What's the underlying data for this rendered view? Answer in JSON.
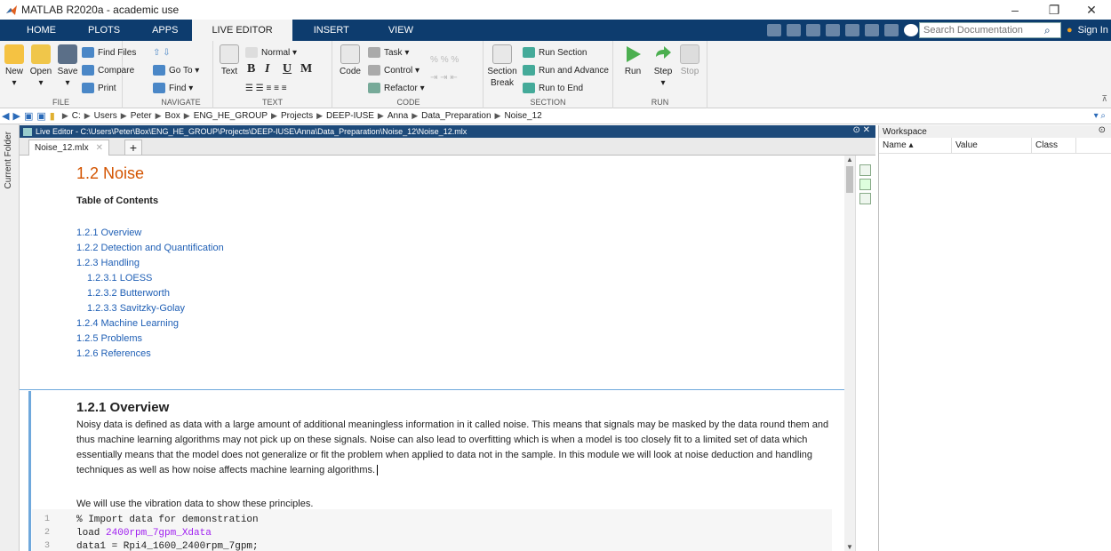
{
  "window": {
    "title": "MATLAB R2020a - academic use",
    "controls": {
      "minimize": "–",
      "restore": "❐",
      "close": "✕"
    }
  },
  "ribbon_tabs": [
    "HOME",
    "PLOTS",
    "APPS",
    "LIVE EDITOR",
    "INSERT",
    "VIEW"
  ],
  "search": {
    "placeholder": "Search Documentation"
  },
  "sign_in": "Sign In",
  "ribbon": {
    "file": {
      "label": "FILE",
      "new": "New",
      "open": "Open",
      "save": "Save",
      "find_files": "Find Files",
      "compare": "Compare",
      "print": "Print"
    },
    "navigate": {
      "label": "NAVIGATE",
      "go_to": "Go To ▾",
      "find": "Find ▾"
    },
    "text": {
      "label": "TEXT",
      "text": "Text",
      "style": "Normal ▾",
      "bold": "B",
      "italic": "I",
      "underline": "U",
      "mono": "M"
    },
    "code": {
      "label": "CODE",
      "code": "Code",
      "task": "Task ▾",
      "control": "Control ▾",
      "refactor": "Refactor ▾"
    },
    "section": {
      "label": "SECTION",
      "break_line1": "Section",
      "break_line2": "Break",
      "run_section": "Run Section",
      "run_and_advance": "Run and Advance",
      "run_to_end": "Run to End"
    },
    "run": {
      "label": "RUN",
      "run": "Run",
      "step": "Step",
      "stop": "Stop"
    }
  },
  "breadcrumbs": [
    "C:",
    "Users",
    "Peter",
    "Box",
    "ENG_HE_GROUP",
    "Projects",
    "DEEP-IUSE",
    "Anna",
    "Data_Preparation",
    "Noise_12"
  ],
  "side_panel": {
    "label": "Current Folder"
  },
  "editor": {
    "title": "Live Editor - C:\\Users\\Peter\\Box\\ENG_HE_GROUP\\Projects\\DEEP-IUSE\\Anna\\Data_Preparation\\Noise_12\\Noise_12.mlx",
    "tab": "Noise_12.mlx",
    "heading": "1.2 Noise",
    "toc_title": "Table of Contents",
    "toc": [
      {
        "label": "1.2.1 Overview",
        "sub": false
      },
      {
        "label": "1.2.2 Detection and Quantification",
        "sub": false
      },
      {
        "label": "1.2.3 Handling",
        "sub": false
      },
      {
        "label": "1.2.3.1 LOESS",
        "sub": true
      },
      {
        "label": "1.2.3.2 Butterworth",
        "sub": true
      },
      {
        "label": "1.2.3.3 Savitzky-Golay",
        "sub": true
      },
      {
        "label": "1.2.4 Machine Learning",
        "sub": false
      },
      {
        "label": "1.2.5 Problems",
        "sub": false
      },
      {
        "label": "1.2.6 References",
        "sub": false
      }
    ],
    "section_heading": "1.2.1 Overview",
    "paragraph": "Noisy data is defined as data with a large amount of additional meaningless information in it called noise. This means that signals may be masked by the data round them and thus machine learning algorithms may not pick up on these signals. Noise can also lead to overfitting which is when a model is too closely fit to a limited set of data which essentially means that the model does not generalize or fit the problem when applied to data not in the sample. In this module we will look at noise deduction and handling techniques as well as how noise affects machine learning algorithms.",
    "paragraph2": "We will use the vibration data to show these principles.",
    "code_lines": [
      {
        "num": "1",
        "comment": "% Import data for demonstration"
      },
      {
        "num": "2",
        "kw": "load ",
        "str": "2400rpm_7gpm_Xdata"
      },
      {
        "num": "3",
        "text": "data1 = Rpi4_1600_2400rpm_7gpm;"
      }
    ]
  },
  "workspace": {
    "title": "Workspace",
    "columns": [
      "Name ▴",
      "Value",
      "Class"
    ]
  }
}
